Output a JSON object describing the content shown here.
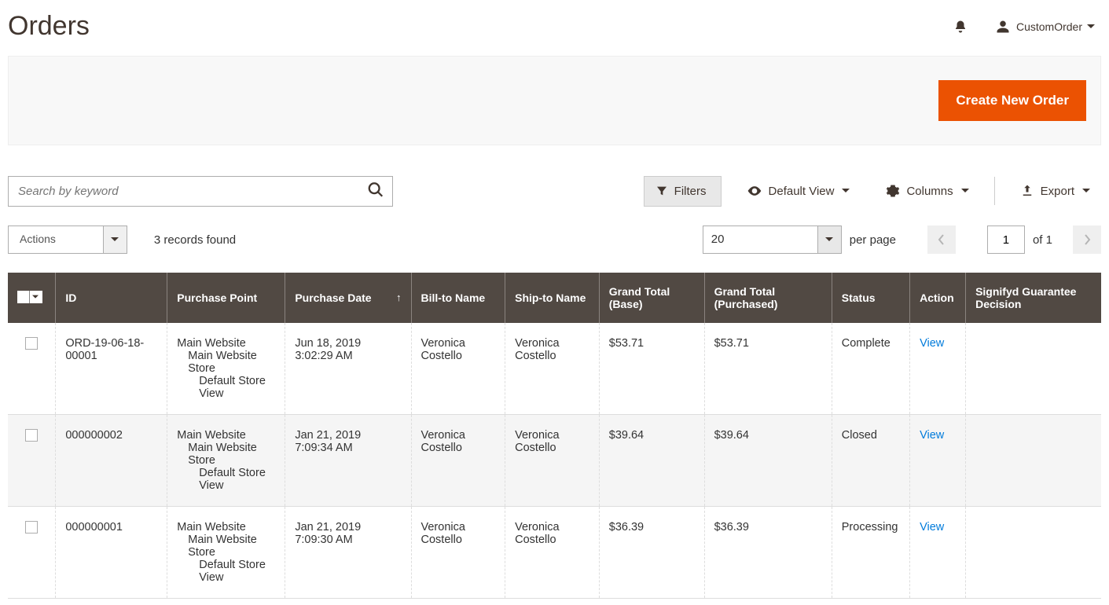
{
  "header": {
    "title": "Orders",
    "user_name": "CustomOrder"
  },
  "action_bar": {
    "create_button": "Create New Order"
  },
  "toolbar": {
    "search_placeholder": "Search by keyword",
    "filters_label": "Filters",
    "default_view_label": "Default View",
    "columns_label": "Columns",
    "export_label": "Export"
  },
  "toolbar2": {
    "actions_label": "Actions",
    "records_found": "3 records found",
    "page_size": "20",
    "per_page_label": "per page",
    "current_page": "1",
    "of_pages": "of 1"
  },
  "table": {
    "columns": {
      "id": "ID",
      "purchase_point": "Purchase Point",
      "purchase_date": "Purchase Date",
      "bill_to": "Bill-to Name",
      "ship_to": "Ship-to Name",
      "grand_total_base": "Grand Total (Base)",
      "grand_total_purchased": "Grand Total (Purchased)",
      "status": "Status",
      "action": "Action",
      "signifyd": "Signifyd Guarantee Decision"
    },
    "purchase_point_lines": {
      "l1": "Main Website",
      "l2": "Main Website Store",
      "l3": "Default Store View"
    },
    "action_link": "View",
    "rows": [
      {
        "id": "ORD-19-06-18-00001",
        "purchase_date": "Jun 18, 2019 3:02:29 AM",
        "bill_to": "Veronica Costello",
        "ship_to": "Veronica Costello",
        "gt_base": "$53.71",
        "gt_purchased": "$53.71",
        "status": "Complete"
      },
      {
        "id": "000000002",
        "purchase_date": "Jan 21, 2019 7:09:34 AM",
        "bill_to": "Veronica Costello",
        "ship_to": "Veronica Costello",
        "gt_base": "$39.64",
        "gt_purchased": "$39.64",
        "status": "Closed"
      },
      {
        "id": "000000001",
        "purchase_date": "Jan 21, 2019 7:09:30 AM",
        "bill_to": "Veronica Costello",
        "ship_to": "Veronica Costello",
        "gt_base": "$36.39",
        "gt_purchased": "$36.39",
        "status": "Processing"
      }
    ]
  }
}
